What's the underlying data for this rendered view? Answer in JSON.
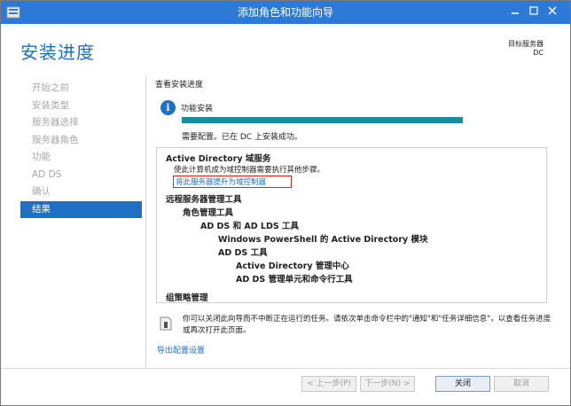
{
  "window": {
    "title": "添加角色和功能向导",
    "controls": {
      "minimize": "—",
      "maximize": "□",
      "close": "✕"
    }
  },
  "header": {
    "title": "安装进度",
    "target_label": "目标服务器",
    "target_value": "DC"
  },
  "nav": {
    "items": [
      {
        "label": "开始之前",
        "active": false
      },
      {
        "label": "安装类型",
        "active": false
      },
      {
        "label": "服务器选择",
        "active": false
      },
      {
        "label": "服务器角色",
        "active": false
      },
      {
        "label": "功能",
        "active": false
      },
      {
        "label": "AD DS",
        "active": false
      },
      {
        "label": "确认",
        "active": false
      },
      {
        "label": "结果",
        "active": true
      }
    ]
  },
  "content": {
    "sub_heading": "查看安装进度",
    "install_type": "功能安装",
    "progress_fraction": 1.0,
    "progress_status": "需要配置。已在 DC 上安装成功。",
    "results": {
      "adds_title": "Active Directory 域服务",
      "adds_desc": "使此计算机成为域控制器需要执行其他步骤。",
      "promote_link": "将此服务器提升为域控制器",
      "rsat": "远程服务器管理工具",
      "role_tools": "角色管理工具",
      "adds_lds_tools": "AD DS 和 AD LDS 工具",
      "ps_module": "Windows PowerShell 的 Active Directory 模块",
      "adds_tools": "AD DS 工具",
      "ad_admin_center": "Active Directory 管理中心",
      "adds_snapins": "AD DS 管理单元和命令行工具",
      "gpm": "组策略管理"
    },
    "note": "你可以关闭此向导而不中断正在运行的任务。请依次单击命令栏中的\"通知\"和\"任务详细信息\"，以查看任务进度或再次打开此页面。",
    "export_link": "导出配置设置"
  },
  "footer": {
    "prev": "< 上一步(P)",
    "next": "下一步(N) >",
    "close": "关闭",
    "cancel": "取消"
  },
  "colors": {
    "titlebar": "#2d7ad6",
    "accent": "#1f6fc5",
    "progress": "#1c8aa3",
    "highlight_outline": "#e02020"
  }
}
